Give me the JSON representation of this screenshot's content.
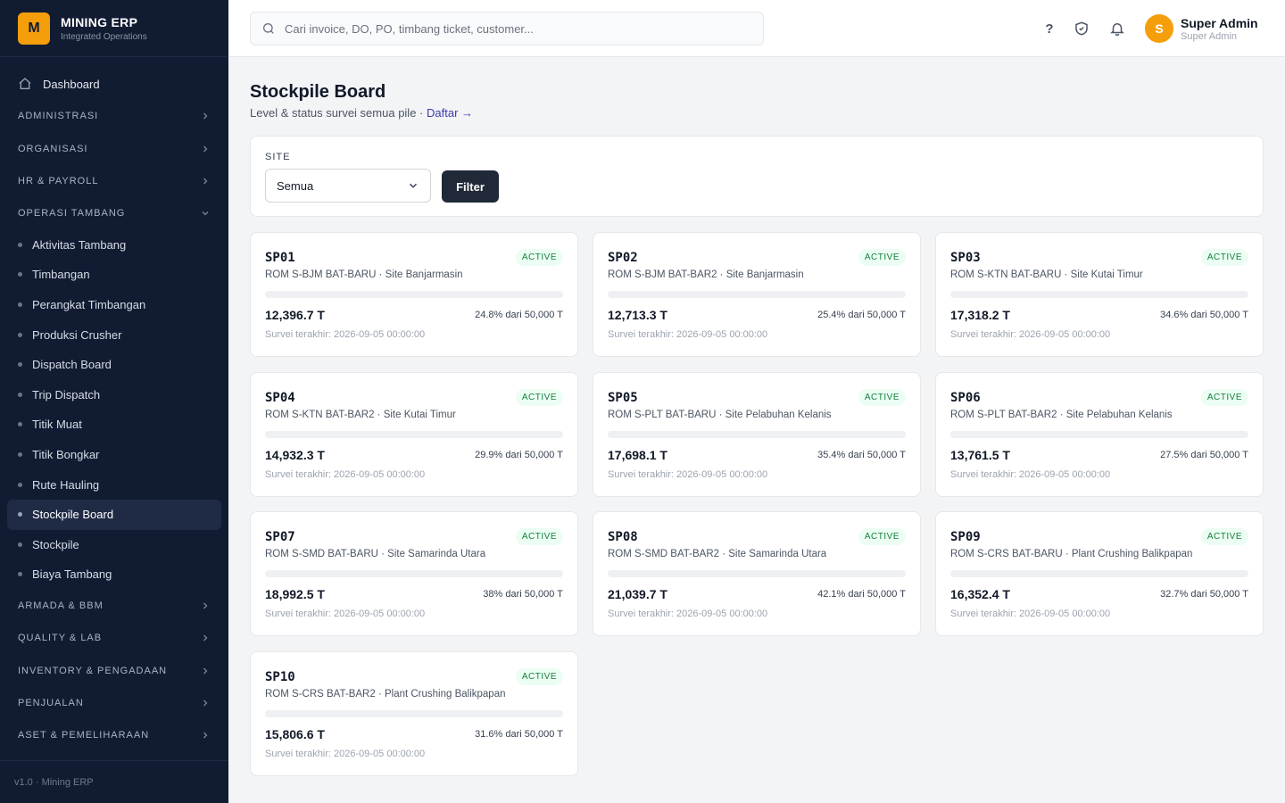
{
  "brand": {
    "logo": "M",
    "title": "MINING ERP",
    "subtitle": "Integrated Operations"
  },
  "sidebar": {
    "dashboard": "Dashboard",
    "groups_top": [
      {
        "label": "ADMINISTRASI"
      },
      {
        "label": "ORGANISASI"
      },
      {
        "label": "HR & PAYROLL"
      },
      {
        "label": "OPERASI TAMBANG"
      }
    ],
    "operasi_items": [
      {
        "label": "Aktivitas Tambang"
      },
      {
        "label": "Timbangan"
      },
      {
        "label": "Perangkat Timbangan"
      },
      {
        "label": "Produksi Crusher"
      },
      {
        "label": "Dispatch Board"
      },
      {
        "label": "Trip Dispatch"
      },
      {
        "label": "Titik Muat"
      },
      {
        "label": "Titik Bongkar"
      },
      {
        "label": "Rute Hauling"
      },
      {
        "label": "Stockpile Board"
      },
      {
        "label": "Stockpile"
      },
      {
        "label": "Biaya Tambang"
      }
    ],
    "groups_bottom": [
      {
        "label": "ARMADA & BBM"
      },
      {
        "label": "QUALITY & LAB"
      },
      {
        "label": "INVENTORY & PENGADAAN"
      },
      {
        "label": "PENJUALAN"
      },
      {
        "label": "ASET & PEMELIHARAAN"
      }
    ],
    "footer": "v1.0 · Mining ERP"
  },
  "topbar": {
    "search_placeholder": "Cari invoice, DO, PO, timbang ticket, customer...",
    "help": "?",
    "user": {
      "initial": "S",
      "name": "Super Admin",
      "role": "Super Admin"
    }
  },
  "page": {
    "title": "Stockpile Board",
    "subtitle": "Level & status survei semua pile ·",
    "link": "Daftar →"
  },
  "filter": {
    "label": "SITE",
    "selected": "Semua",
    "button": "Filter"
  },
  "stockpiles": [
    {
      "code": "SP01",
      "status": "ACTIVE",
      "desc": "ROM S-BJM BAT-BARU · Site Banjarmasin",
      "tonnage": "12,396.7 T",
      "percent": 24.8,
      "percent_text": "24.8% dari 50,000 T",
      "survey": "Survei terakhir: 2026-09-05 00:00:00"
    },
    {
      "code": "SP02",
      "status": "ACTIVE",
      "desc": "ROM S-BJM BAT-BAR2 · Site Banjarmasin",
      "tonnage": "12,713.3 T",
      "percent": 25.4,
      "percent_text": "25.4% dari 50,000 T",
      "survey": "Survei terakhir: 2026-09-05 00:00:00"
    },
    {
      "code": "SP03",
      "status": "ACTIVE",
      "desc": "ROM S-KTN BAT-BARU · Site Kutai Timur",
      "tonnage": "17,318.2 T",
      "percent": 34.6,
      "percent_text": "34.6% dari 50,000 T",
      "survey": "Survei terakhir: 2026-09-05 00:00:00"
    },
    {
      "code": "SP04",
      "status": "ACTIVE",
      "desc": "ROM S-KTN BAT-BAR2 · Site Kutai Timur",
      "tonnage": "14,932.3 T",
      "percent": 29.9,
      "percent_text": "29.9% dari 50,000 T",
      "survey": "Survei terakhir: 2026-09-05 00:00:00"
    },
    {
      "code": "SP05",
      "status": "ACTIVE",
      "desc": "ROM S-PLT BAT-BARU · Site Pelabuhan Kelanis",
      "tonnage": "17,698.1 T",
      "percent": 35.4,
      "percent_text": "35.4% dari 50,000 T",
      "survey": "Survei terakhir: 2026-09-05 00:00:00"
    },
    {
      "code": "SP06",
      "status": "ACTIVE",
      "desc": "ROM S-PLT BAT-BAR2 · Site Pelabuhan Kelanis",
      "tonnage": "13,761.5 T",
      "percent": 27.5,
      "percent_text": "27.5% dari 50,000 T",
      "survey": "Survei terakhir: 2026-09-05 00:00:00"
    },
    {
      "code": "SP07",
      "status": "ACTIVE",
      "desc": "ROM S-SMD BAT-BARU · Site Samarinda Utara",
      "tonnage": "18,992.5 T",
      "percent": 38,
      "percent_text": "38% dari 50,000 T",
      "survey": "Survei terakhir: 2026-09-05 00:00:00"
    },
    {
      "code": "SP08",
      "status": "ACTIVE",
      "desc": "ROM S-SMD BAT-BAR2 · Site Samarinda Utara",
      "tonnage": "21,039.7 T",
      "percent": 42.1,
      "percent_text": "42.1% dari 50,000 T",
      "survey": "Survei terakhir: 2026-09-05 00:00:00"
    },
    {
      "code": "SP09",
      "status": "ACTIVE",
      "desc": "ROM S-CRS BAT-BARU · Plant Crushing Balikpapan",
      "tonnage": "16,352.4 T",
      "percent": 32.7,
      "percent_text": "32.7% dari 50,000 T",
      "survey": "Survei terakhir: 2026-09-05 00:00:00"
    },
    {
      "code": "SP10",
      "status": "ACTIVE",
      "desc": "ROM S-CRS BAT-BAR2 · Plant Crushing Balikpapan",
      "tonnage": "15,806.6 T",
      "percent": 31.6,
      "percent_text": "31.6% dari 50,000 T",
      "survey": "Survei terakhir: 2026-09-05 00:00:00"
    }
  ],
  "colors": {
    "sidebar_bg": "#111c33",
    "accent": "#f59e0b",
    "active_badge": "#15803d",
    "link": "#3b3bb0"
  }
}
